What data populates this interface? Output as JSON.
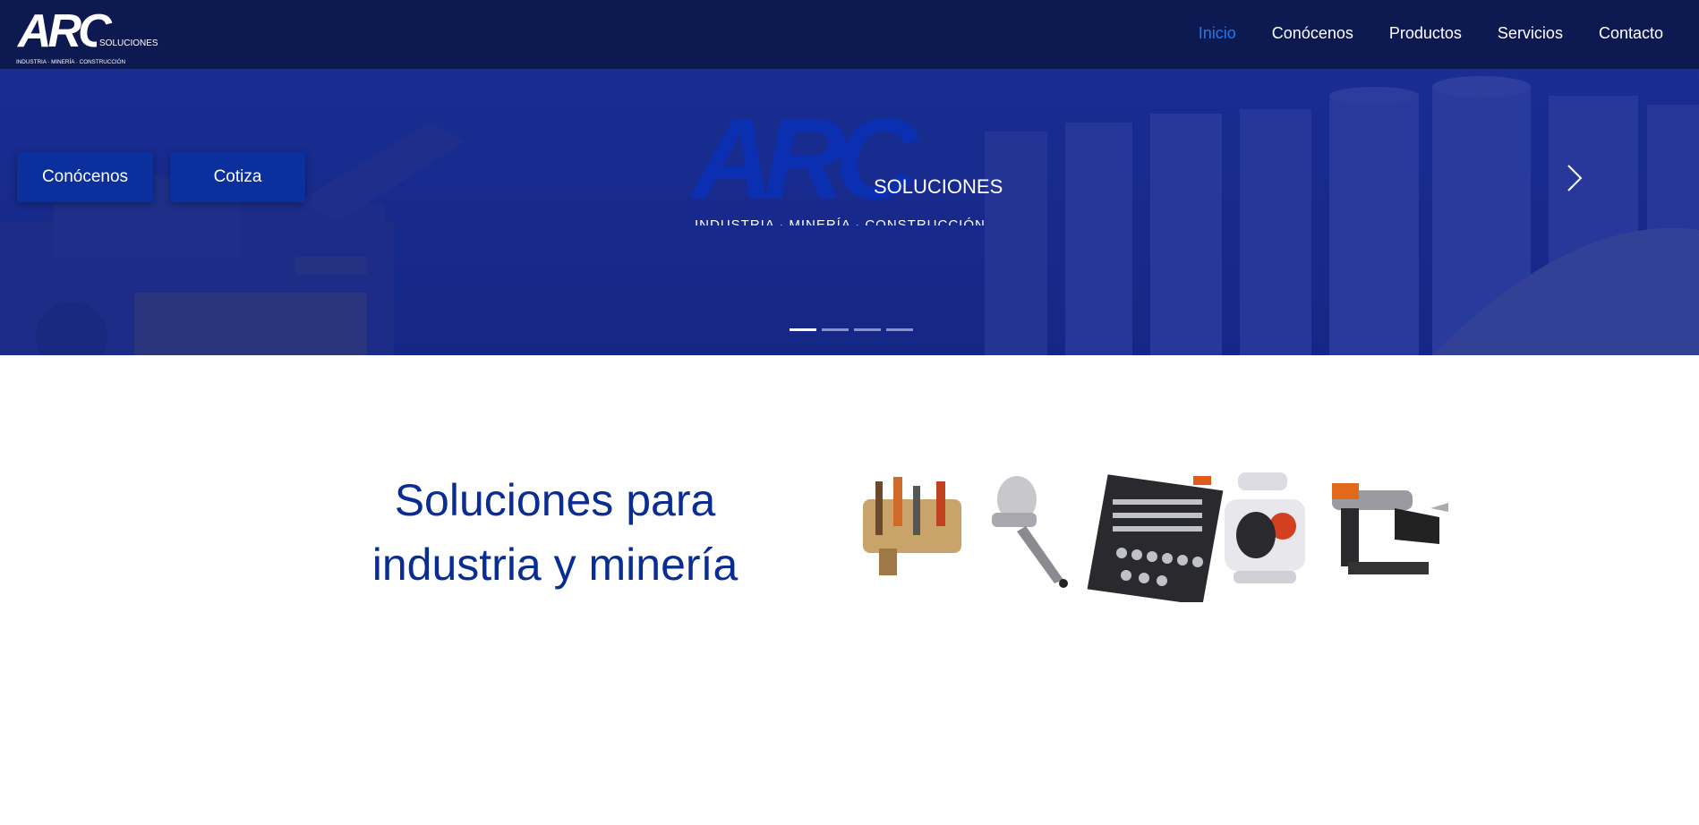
{
  "brand": {
    "logo_text": "ARC",
    "logo_sub": "SOLUCIONES",
    "tagline": "INDUSTRIA · MINERÍA · CONSTRUCCIÓN"
  },
  "nav": {
    "items": [
      {
        "label": "Inicio",
        "active": true
      },
      {
        "label": "Conócenos",
        "active": false
      },
      {
        "label": "Productos",
        "active": false
      },
      {
        "label": "Servicios",
        "active": false
      },
      {
        "label": "Contacto",
        "active": false
      }
    ]
  },
  "hero": {
    "buttons": {
      "conocenos": "Conócenos",
      "cotiza": "Cotiza"
    },
    "logo_text": "ARC",
    "logo_sub": "SOLUCIONES",
    "tagline": "INDUSTRIA · MINERÍA · CONSTRUCCIÓN",
    "slides_count": 4,
    "active_slide": 1,
    "next_icon": "chevron-right-icon"
  },
  "intro": {
    "title_line1": "Soluciones para",
    "title_line2": "industria y minería"
  },
  "products": [
    "tool-belt",
    "spray-gun",
    "socket-set",
    "diaphragm-pump",
    "nail-gun"
  ],
  "colors": {
    "navbar": "#0d1a52",
    "accent": "#1e78e8",
    "button": "#0b2f9c",
    "title": "#0a2d94",
    "hero_overlay": "#12248c"
  }
}
